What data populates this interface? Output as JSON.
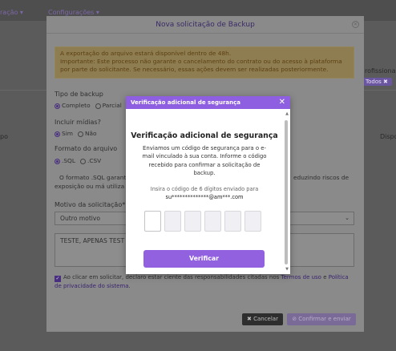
{
  "background": {
    "nav_left": "ração ▾",
    "nav_configuracoes": "Configurações ▾",
    "right_label": "rofissional",
    "chip_label": "Todos ✖",
    "left_col": "po",
    "right_col": "Dispo"
  },
  "modal": {
    "title": "Nova solicitação de Backup",
    "alert_line1": "A exportação do arquivo estará disponível dentro de 48h.",
    "alert_line2": "Importante: Este processo não garante o cancelamento do contrato ou do acesso à plataforma por parte do solicitante. Se necessário, essas ações devem ser realizadas posteriormente.",
    "backup_type_label": "Tipo de backup",
    "backup_type_options": [
      "Completo",
      "Parcial"
    ],
    "include_media_label": "Incluir mídias?",
    "include_media_options": [
      "Sim",
      "Não"
    ],
    "file_format_label": "Formato do arquivo",
    "file_format_options": [
      ".SQL",
      ".CSV"
    ],
    "format_note_start": "O formato .SQL garante",
    "format_note_end": "eduzindo riscos de",
    "format_note_line2": "exposição ou má utiliza",
    "reason_label": "Motivo da solicitação*",
    "reason_value": "Outro motivo",
    "textarea_value": "TESTE, APENAS TEST",
    "consent_text": "Ao clicar em solicitar, declaro estar ciente das responsabilidades citadas nos ",
    "terms_link": "Termos de uso",
    "consent_and": " e ",
    "privacy_link": "Política de privacidade do sistema",
    "consent_end": ".",
    "cancel_label": "✖ Cancelar",
    "confirm_label": "⊘ Confirmar e enviar"
  },
  "security": {
    "header": "Verificação adicional de segurança",
    "title": "Verificação adicional de segurança",
    "description": "Enviamos um código de segurança para o e-mail vinculado à sua conta. Informe o código recebido para confirmar a solicitação de backup.",
    "hint": "Insira o código de 6 dígitos enviado para",
    "email_masked": "su**************@am***.com",
    "verify_label": "Verificar",
    "code_digits": [
      "",
      "",
      "",
      "",
      "",
      ""
    ]
  }
}
